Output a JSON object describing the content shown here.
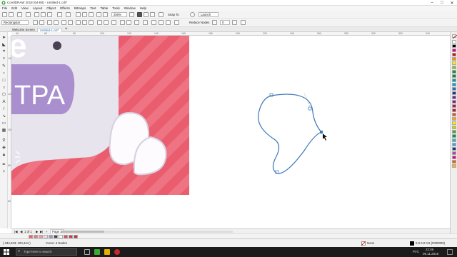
{
  "window": {
    "title": "CorelDRAW 2018 (64-Bit) - Untitled-1.cdr*",
    "controls": [
      "–",
      "□",
      "✕"
    ]
  },
  "menu": [
    "File",
    "Edit",
    "View",
    "Layout",
    "Object",
    "Effects",
    "Bitmaps",
    "Text",
    "Table",
    "Tools",
    "Window",
    "Help"
  ],
  "toolbar": {
    "zoom": "250%",
    "snap_label": "Snap To",
    "launch_label": "Launch"
  },
  "propbar": {
    "shape_type": "Rectangular",
    "reduce_nodes_label": "Reduce Nodes",
    "reduce_value": "0"
  },
  "tabs": [
    {
      "label": "Welcome Screen"
    },
    {
      "label": "Untitled-1.cdr*"
    }
  ],
  "hruler_ticks": [
    "40",
    "60",
    "80",
    "100",
    "120",
    "140",
    "160",
    "180",
    "200",
    "220",
    "240",
    "260",
    "280",
    "300",
    "320",
    "340"
  ],
  "vruler_ticks": [
    "140",
    "120",
    "100",
    "80",
    "60"
  ],
  "artwork": {
    "text": "TPA",
    "letter": "e",
    "colors": {
      "bg": "#e95d6f",
      "stripe": "#ef7483",
      "body": "#e8e4ee",
      "label": "#a98fce",
      "text": "#ffffff",
      "dark": "#4a4152"
    }
  },
  "pages": {
    "counter": "1 of 1",
    "tab": "Page 1"
  },
  "status": {
    "cursor": "( 344,623; 100,444 )",
    "info": "Curve: 4 Nodes",
    "fill": "None",
    "outline": "0,0 0,0 0,0 (#000000)"
  },
  "taskbar": {
    "search_placeholder": "Type here to search",
    "time": "22:06",
    "date": "06.11.2018",
    "lang": "РУС"
  },
  "palette": [
    "#ffffff",
    "#000000",
    "#e6007e",
    "#e30613",
    "#f39200",
    "#ffed00",
    "#95c11f",
    "#009640",
    "#008d36",
    "#00a19a",
    "#009fe3",
    "#1d71b8",
    "#2d2e83",
    "#662483",
    "#951b81",
    "#a3195b",
    "#be1622",
    "#e94e1b",
    "#f6a800",
    "#fcea10",
    "#c6d300",
    "#3aaa35",
    "#00983a",
    "#27b8c4",
    "#36a9e1",
    "#312783",
    "#ad4a95",
    "#e5007d",
    "#ea5b0c",
    "#fbba00"
  ],
  "doc_palette": [
    "#e95d6f",
    "#ef7483",
    "#f19aa3",
    "#e8e4ee",
    "#a98fce",
    "#4a4152",
    "#ffffff",
    "#d94a5c",
    "#c73a4b",
    "#b63342"
  ]
}
